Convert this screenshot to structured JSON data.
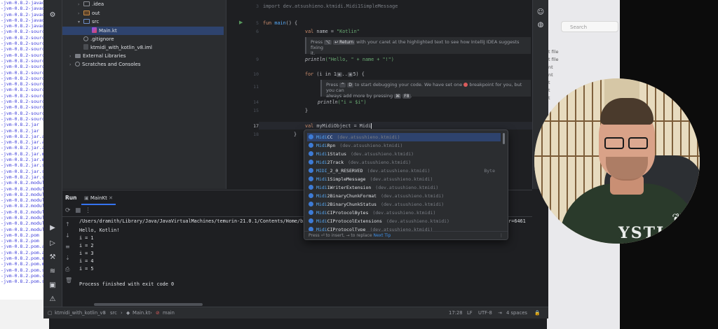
{
  "bg_left_lines": [
    "-jvm-0.8.2-javad",
    "-jvm-0.8.2-javad",
    "-jvm-0.8.2-javad",
    "-jvm-0.8.2-javad",
    "-jvm-0.8.2-javad",
    "-jvm-0.8.2-sourc",
    "-jvm-0.8.2-sourc",
    "-jvm-0.8.2-sourc",
    "-jvm-0.8.2-sourc",
    "-jvm-0.8.2-sourc",
    "-jvm-0.8.2-sourc",
    "-jvm-0.8.2-sourc",
    "-jvm-0.8.2-sourc",
    "-jvm-0.8.2-sourc",
    "-jvm-0.8.2-sourc",
    "-jvm-0.8.2-sourc",
    "-jvm-0.8.2-sourc",
    "-jvm-0.8.2-sourc",
    "-jvm-0.8.2-sourc",
    "-jvm-0.8.2-sourc",
    "-jvm-0.8.2-sourc",
    "-jvm-0.8.2.jar",
    "-jvm-0.8.2.jar",
    "-jvm-0.8.2.jar.as",
    "-jvm-0.8.2.jar.as",
    "-jvm-0.8.2.jar.as",
    "-jvm-0.8.2.jar.md",
    "-jvm-0.8.2.jar.md",
    "-jvm-0.8.2.jar.sh",
    "-jvm-0.8.2.jar.sh",
    "-jvm-0.8.2.jar.sh",
    "-jvm-0.8.2.module",
    "-jvm-0.8.2.module",
    "-jvm-0.8.2.module",
    "-jvm-0.8.2.module",
    "-jvm-0.8.2.module",
    "-jvm-0.8.2.module",
    "-jvm-0.8.2.module",
    "-jvm-0.8.2.module",
    "-jvm-0.8.2.module",
    "-jvm-0.8.2.pom",
    "-jvm-0.8.2.pom",
    "-jvm-0.8.2.pom.as",
    "-jvm-0.8.2.pom.as",
    "-jvm-0.8.2.pom.md",
    "-jvm-0.8.2.pom.md",
    "-jvm-0.8.2.pom.sh",
    "-jvm-0.8.2.pom.sh",
    "-jvm-0.8.2.pom.sh"
  ],
  "bg_right": {
    "search_placeholder": "Search",
    "items": [
      "t file",
      "t file",
      "nt",
      "nt",
      "t",
      "t",
      "t"
    ]
  },
  "project_tree": [
    {
      "label": ".idea",
      "indent": 1,
      "kind": "folder",
      "expanded": false
    },
    {
      "label": "out",
      "indent": 1,
      "kind": "folder-out",
      "expanded": false
    },
    {
      "label": "src",
      "indent": 1,
      "kind": "folder-src",
      "expanded": true
    },
    {
      "label": "Main.kt",
      "indent": 2,
      "kind": "kt",
      "selected": true
    },
    {
      "label": ".gitignore",
      "indent": 1,
      "kind": "git"
    },
    {
      "label": "ktmidi_with_kotlin_v8.iml",
      "indent": 1,
      "kind": "iml"
    },
    {
      "label": "External Libraries",
      "indent": 0,
      "kind": "lib",
      "expanded": false
    },
    {
      "label": "Scratches and Consoles",
      "indent": 0,
      "kind": "scr",
      "expanded": false
    }
  ],
  "editor": {
    "line_numbers": [
      "3",
      "5",
      "6",
      "",
      "",
      "9",
      "10",
      "11",
      "",
      "",
      "14",
      "15",
      "",
      "17",
      "18"
    ],
    "import_line": "import dev.atsushieno.ktmidi.Midi1SimpleMessage",
    "fun_kw": "fun",
    "fun_name": "main",
    "fun_rest": "() {",
    "val_kw": "val",
    "name_decl": " name = ",
    "name_value": "\"Kotlin\"",
    "hint1_a": "Press",
    "hint1_key1": "⌥",
    "hint1_key2": "↩ Return",
    "hint1_b": "with your caret at the highlighted text to see how IntelliJ IDEA suggests fixing",
    "hint1_c": "it.",
    "println1": "println",
    "println1_args": "(\"Hello, \" + name + \"!\")",
    "for_kw": "for",
    "for_rest": " (i in 1",
    "for_hint1": "≤",
    "for_dots": "..",
    "for_hint2": "≤",
    "for_end": "5) {",
    "hint2_a": "Press",
    "hint2_key1": "^",
    "hint2_key2": "D",
    "hint2_b": "to start debugging your code. We have set one",
    "hint2_c": "breakpoint for you, but you can",
    "hint2_d": "always add more by pressing",
    "hint2_key3": "⌘",
    "hint2_key4": "F8",
    "hint2_e": ".",
    "println2": "println",
    "println2_args": "(\"i = $i\")",
    "close_brace": "}",
    "val2_rest": " myMidiObject = Midi",
    "close_brace2": "}"
  },
  "completion": {
    "items": [
      {
        "m": "Midi",
        "r": "CC",
        "pkg": "(dev.atsushieno.ktmidi)",
        "type": ""
      },
      {
        "m": "Midi",
        "r": "Rpn",
        "pkg": "(dev.atsushieno.ktmidi)",
        "type": ""
      },
      {
        "m": "Midi",
        "r": "1Status",
        "pkg": "(dev.atsushieno.ktmidi)",
        "type": ""
      },
      {
        "m": "Midi",
        "r": "2Track",
        "pkg": "(dev.atsushieno.ktmidi)",
        "type": ""
      },
      {
        "m": "MIDI",
        "r": "_2_0_RESERVED",
        "pkg": "(dev.atsushieno.ktmidi)",
        "type": "Byte"
      },
      {
        "m": "Midi",
        "r": "1SimpleMessage",
        "pkg": "(dev.atsushieno.ktmidi)",
        "type": ""
      },
      {
        "m": "Midi",
        "r": "1WriterExtension",
        "pkg": "(dev.atsushieno.ktmidi)",
        "type": ""
      },
      {
        "m": "Midi",
        "r": "2BinaryChunkFormat",
        "pkg": "(dev.atsushieno.ktmidi)",
        "type": ""
      },
      {
        "m": "Midi",
        "r": "2BinaryChunkStatus",
        "pkg": "(dev.atsushieno.ktmidi)",
        "type": ""
      },
      {
        "m": "Midi",
        "r": "CIProtocolBytes",
        "pkg": "(dev.atsushieno.ktmidi)",
        "type": ""
      },
      {
        "m": "Midi",
        "r": "CIProtocolExtensions",
        "pkg": "(dev.atsushieno.ktmidi)",
        "type": ""
      },
      {
        "m": "Midi",
        "r": "CIProtocolType",
        "pkg": "(dev.atsushieno.ktmidi)",
        "type": ""
      }
    ],
    "footer": "Press ⏎ to insert, → to replace",
    "footer_link": "Next Tip"
  },
  "run_panel": {
    "title": "Run",
    "tab_label": "MainKt",
    "console_lines": [
      "/Users/dramith/Library/Java/JavaVirtualMachines/temurin-21.0.1/Contents/Home/bin",
      "Hello, Kotlin!",
      "i = 1",
      "i = 2",
      "i = 3",
      "i = 4",
      "i = 5",
      "",
      "Process finished with exit code 0"
    ],
    "console_tail": "jar=6461"
  },
  "statusbar": {
    "crumbs": [
      "ktmidi_with_kotlin_v8",
      "src",
      "Main.kt",
      "main"
    ],
    "position": "17:28",
    "line_sep": "LF",
    "encoding": "UTF-8",
    "indent": "4 spaces"
  },
  "webcam": {
    "shirt_text": "YSTI"
  },
  "colors": {
    "accent": "#3574f0",
    "breakpoint": "#db5c5c",
    "keyword": "#cf8e6d",
    "string": "#6aab73",
    "function": "#56a8f5"
  }
}
